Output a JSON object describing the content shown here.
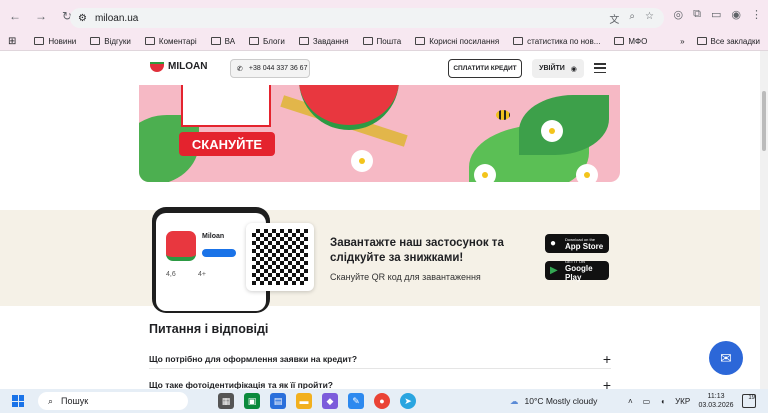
{
  "browser": {
    "url": "miloan.ua",
    "bookmarks": [
      "Новини",
      "Відгуки",
      "Коментарі",
      "ВА",
      "Блоги",
      "Завдання",
      "Пошта",
      "Корисні посилання",
      "статистика по нов...",
      "МФО"
    ],
    "all_bookmarks": "Все закладки"
  },
  "site": {
    "logo": "MILOAN",
    "phone": "+38 044 337 36 67",
    "pay_button": "СПЛАТИТИ КРЕДИТ",
    "login_button": "УВІЙТИ"
  },
  "banner": {
    "scan_label": "СКАНУЙТЕ"
  },
  "app_promo": {
    "title": "Завантажте наш застосунок та слідкуйте за знижками!",
    "subtitle": "Скануйте QR код для завантаження",
    "app_name": "Miloan",
    "app_store": {
      "small": "Download on the",
      "big": "App Store"
    },
    "google_play": {
      "small": "GET IT ON",
      "big": "Google Play"
    },
    "rating": "4,6",
    "age": "4+"
  },
  "faq": {
    "title": "Питання і відповіді",
    "items": [
      "Що потрібно для оформлення заявки на кредит?",
      "Що таке фотоідентифікація та як її пройти?"
    ]
  },
  "taskbar": {
    "search": "Пошук",
    "weather": "10°C  Mostly cloudy",
    "lang": "УКР",
    "time": "11:13",
    "date": "03.03.2026",
    "notif": "19"
  }
}
